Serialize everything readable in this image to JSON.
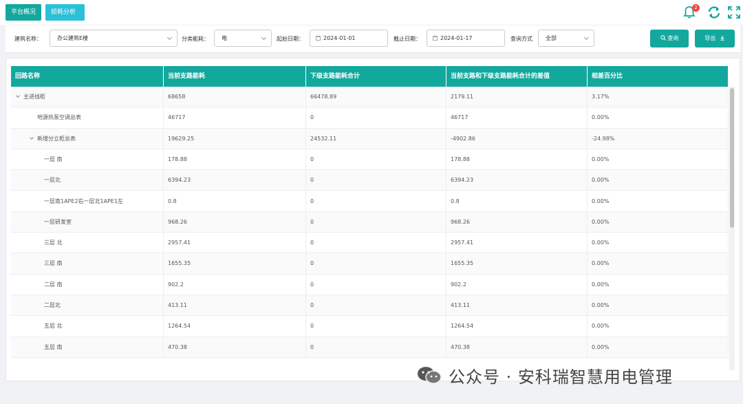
{
  "tabs": [
    {
      "label": "平台概况"
    },
    {
      "label": "损耗分析",
      "close": "×"
    }
  ],
  "notifications": {
    "count": "2"
  },
  "colors": {
    "primary": "#13a89e",
    "tab_active": "#2cc0d8",
    "badge": "#f0483e"
  },
  "icons": {
    "bell": "bell-icon",
    "refresh": "refresh-icon",
    "fullscreen": "fullscreen-icon",
    "search": "search-icon",
    "download": "download-icon",
    "calendar": "calendar-icon"
  },
  "filters": {
    "building_label": "建筑名称：",
    "building_value": "办公建筑E楼",
    "category_label": "分类能耗：",
    "category_value": "电",
    "start_label": "起始日期：",
    "start_value": "2024-01-01",
    "end_label": "截止日期：",
    "end_value": "2024-01-17",
    "query_mode_label": "查询方式",
    "query_mode_value": "全部",
    "query_button": "查询",
    "export_button": "导出"
  },
  "table": {
    "headers": [
      "回路名称",
      "当前支路能耗",
      "下级支路能耗合计",
      "当前支路和下级支路能耗合计的差值",
      "相差百分比"
    ],
    "rows": [
      {
        "name": "主进线柜",
        "level": 0,
        "expand": true,
        "current": "68658",
        "sub_total": "66478.89",
        "diff": "2179.11",
        "pct": "3.17%"
      },
      {
        "name": "地源热泵空调总表",
        "level": 1,
        "expand": false,
        "current": "46717",
        "sub_total": "0",
        "diff": "46717",
        "pct": "0.00%"
      },
      {
        "name": "新增分立柜总表",
        "level": 1,
        "expand": true,
        "current": "19629.25",
        "sub_total": "24532.11",
        "diff": "-4902.86",
        "pct": "-24.98%"
      },
      {
        "name": "一层 南",
        "level": 2,
        "expand": false,
        "current": "178.88",
        "sub_total": "0",
        "diff": "178.88",
        "pct": "0.00%"
      },
      {
        "name": "一层北",
        "level": 2,
        "expand": false,
        "current": "6394.23",
        "sub_total": "0",
        "diff": "6394.23",
        "pct": "0.00%"
      },
      {
        "name": "一层南1APE2右一层北1APE1左",
        "level": 2,
        "expand": false,
        "current": "0.8",
        "sub_total": "0",
        "diff": "0.8",
        "pct": "0.00%"
      },
      {
        "name": "一层研发室",
        "level": 2,
        "expand": false,
        "current": "968.26",
        "sub_total": "0",
        "diff": "968.26",
        "pct": "0.00%"
      },
      {
        "name": "三层 北",
        "level": 2,
        "expand": false,
        "current": "2957.41",
        "sub_total": "0",
        "diff": "2957.41",
        "pct": "0.00%"
      },
      {
        "name": "三层 南",
        "level": 2,
        "expand": false,
        "current": "1655.35",
        "sub_total": "0",
        "diff": "1655.35",
        "pct": "0.00%"
      },
      {
        "name": "二层 南",
        "level": 2,
        "expand": false,
        "current": "902.2",
        "sub_total": "0",
        "diff": "902.2",
        "pct": "0.00%"
      },
      {
        "name": "二层北",
        "level": 2,
        "expand": false,
        "current": "413.11",
        "sub_total": "0",
        "diff": "413.11",
        "pct": "0.00%"
      },
      {
        "name": "五层 北",
        "level": 2,
        "expand": false,
        "current": "1264.54",
        "sub_total": "0",
        "diff": "1264.54",
        "pct": "0.00%"
      },
      {
        "name": "五层 南",
        "level": 2,
        "expand": false,
        "current": "470.38",
        "sub_total": "0",
        "diff": "470.38",
        "pct": "0.00%"
      }
    ]
  },
  "watermark": {
    "text": "公众号 · 安科瑞智慧用电管理"
  }
}
